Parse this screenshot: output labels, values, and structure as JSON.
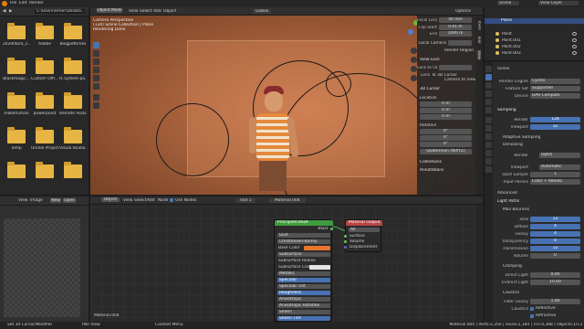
{
  "topbar": {
    "menus": [
      "File",
      "Edit",
      "Render",
      "Window",
      "Help"
    ],
    "scene_label": "Scene",
    "viewlayer_label": "View Layer",
    "global": "Global",
    "options": "Options"
  },
  "filebrowser": {
    "path": "C:\\Users\\Omer\\Deskto...",
    "items": [
      {
        "name": "20200824_1..."
      },
      {
        "name": "Adobe"
      },
      {
        "name": "blogpettimes"
      },
      {
        "name": "Blackmagic..."
      },
      {
        "name": "Custom Offi..."
      },
      {
        "name": "fs system pa..."
      },
      {
        "name": "makehuman"
      },
      {
        "name": "powerpoint"
      },
      {
        "name": "Remote Assis..."
      },
      {
        "name": "Temp"
      },
      {
        "name": "Unreal Project"
      },
      {
        "name": "Visual Studio..."
      },
      {
        "name": ""
      },
      {
        "name": ""
      },
      {
        "name": ""
      }
    ]
  },
  "imageeditor": {
    "view": "View",
    "image": "Image",
    "new": "New",
    "open": "Open"
  },
  "viewport": {
    "mode": "Object Mode",
    "menus": [
      "View",
      "Select",
      "Add",
      "Object"
    ],
    "info_line1": "Camera Perspective",
    "info_line2": "(134) Scene Collection | Plane",
    "info_line3": "Rendering Done",
    "nav_tabs": [
      "Item",
      "Tool",
      "View"
    ]
  },
  "npanel": {
    "focal_length_label": "Focal Length",
    "focal_length": "50 mm",
    "clip_start_label": "Clip Start",
    "clip_start": "0.01 m",
    "clip_end_label": "End",
    "clip_end": "1000 m",
    "local_camera": "Local Camera",
    "render_region": "Render Region",
    "view_lock": "View Lock",
    "lock_to_object": "Lock to Object",
    "lock_label": "Lock",
    "lock_value": "To 3D Cursor",
    "camera_to_view": "Camera to View",
    "cursor_header": "3D Cursor",
    "location_label": "Location",
    "lx": "0 m",
    "ly": "0 m",
    "lz": "0 m",
    "rotation_label": "Rotation",
    "rx": "0°",
    "ry": "0°",
    "rz": "0°",
    "rotation_mode": "Quaternion (WXYZ)",
    "collections": "Collections",
    "annotations": "Annotations"
  },
  "nodeeditor": {
    "object_label": "Object",
    "menus": [
      "View",
      "Select",
      "Add",
      "Node"
    ],
    "use_nodes": "Use Nodes",
    "slot": "Slot 1",
    "material": "Material.004",
    "bottom_material": "Material.004",
    "bsdf_title": "Principled BSDF",
    "bsdf_out": "BSDF",
    "bsdf_rows": [
      "GGX",
      "Christensen-Burley",
      "Base Color",
      "Subsurface",
      "Subsurface Radius",
      "Subsurface Color",
      "Metallic",
      "Specular",
      "Specular Tint",
      "Roughness",
      "Anisotropic",
      "Anisotropic Rotation",
      "Sheen",
      "Sheen Tint"
    ],
    "output_title": "Material Output",
    "output_target": "All",
    "output_rows": [
      "Surface",
      "Volume",
      "Displacement"
    ]
  },
  "outliner": {
    "items": [
      {
        "name": "Point"
      },
      {
        "name": "Point.001"
      },
      {
        "name": "Point.002"
      },
      {
        "name": "Point.003"
      }
    ],
    "highlight": "Plane"
  },
  "properties": {
    "scene": "Scene",
    "render_engine_label": "Render Engine",
    "render_engine": "Cycles",
    "feature_set_label": "Feature Set",
    "feature_set": "Supported",
    "device_label": "Device",
    "device": "GPU Compute",
    "sampling": "Sampling",
    "render_label": "Render",
    "render_value": "128",
    "viewport_label": "Viewport",
    "viewport_value": "32",
    "adaptive_sampling": "Adaptive Sampling",
    "denoising": "Denoising",
    "denoise_render_label": "Render",
    "denoise_render": "OptiX",
    "denoise_viewport_label": "Viewport",
    "denoise_viewport": "Automatic",
    "start_sample_label": "Start Sample",
    "start_sample": "1",
    "input_passes_label": "Input Passes",
    "input_passes": "Color + Albedo",
    "advanced": "Advanced",
    "light_paths": "Light Paths",
    "max_bounces": "Max Bounces",
    "total_label": "Total",
    "total": "12",
    "diffuse_label": "Diffuse",
    "diffuse": "4",
    "glossy_label": "Glossy",
    "glossy": "4",
    "transparency_label": "Transparency",
    "transparency": "8",
    "transmission_label": "Transmission",
    "transmission": "12",
    "volume_label": "Volume",
    "volume": "0",
    "clamping": "Clamping",
    "direct_light_label": "Direct Light",
    "direct_light": "0.00",
    "indirect_light_label": "Indirect Light",
    "indirect_light": "10.00",
    "caustics": "Caustics",
    "filter_glossy_label": "Filter Glossy",
    "filter_glossy": "1.00",
    "caustics_label": "Caustics",
    "reflective": "Reflective",
    "refractive": "Refractive"
  },
  "statusbar": {
    "select": "Set 3d Cursor/Modifier",
    "pan": "Pan View",
    "menu": "Context Menu",
    "version": "Material.004 | Verts:2,350 | Faces:2,184 | Tris:4,368 | Objects:1/13"
  },
  "colors": {
    "accent": "#4772b3",
    "bsdf_header": "#3f9b3f",
    "output_header": "#b84444",
    "folder": "#e7b544",
    "viewport_bg": "#9a5c3c"
  }
}
